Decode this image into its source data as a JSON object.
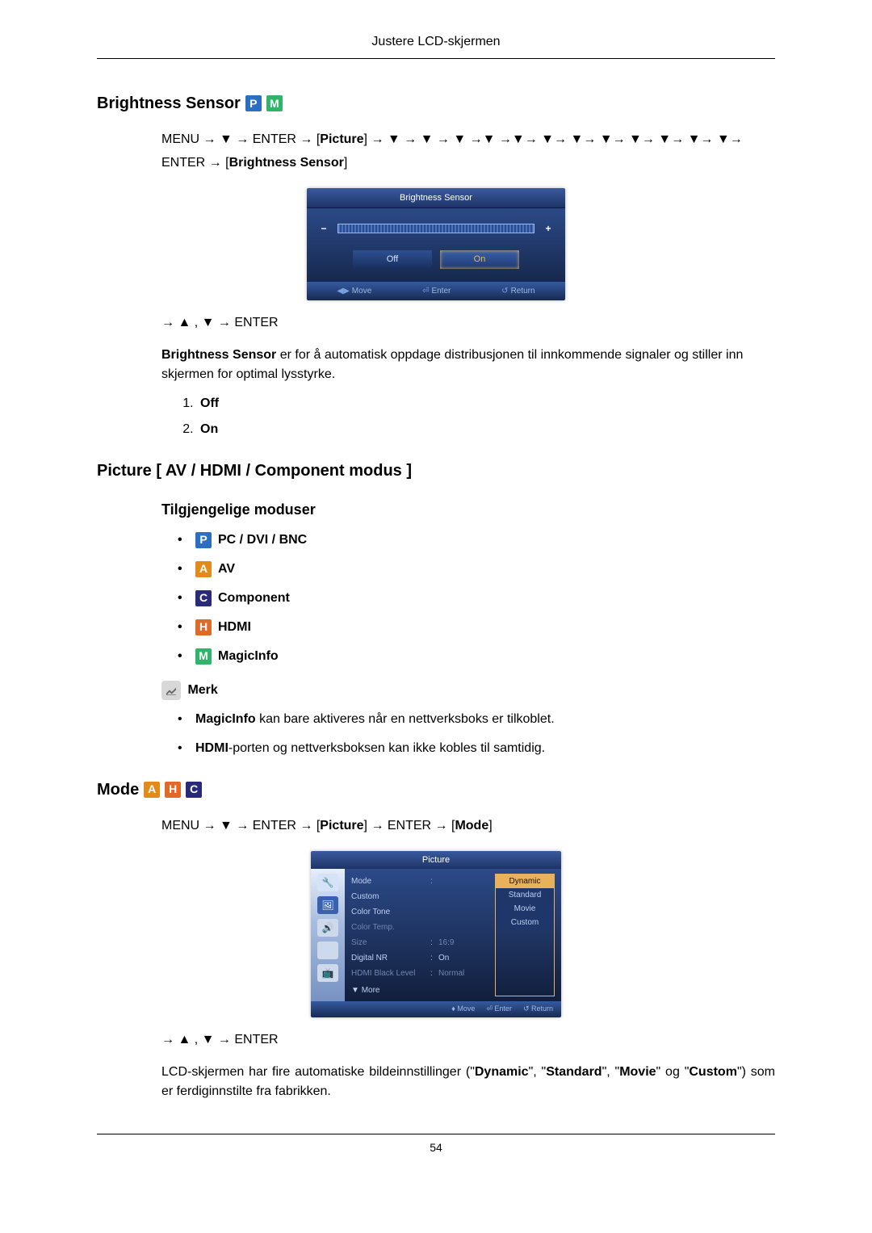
{
  "header": {
    "title": "Justere LCD-skjermen"
  },
  "brightness_sensor": {
    "title": "Brightness Sensor",
    "path_line1_prefix": "MENU → ▼ → ENTER → [",
    "path_line1_picture": "Picture",
    "path_line1_suffix": "] → ▼ → ▼ → ▼ →▼ →▼→ ▼→ ▼→ ▼→ ▼→ ▼→ ▼→ ▼→",
    "path_line2_prefix": "ENTER → [",
    "path_line2_label": "Brightness Sensor",
    "path_line2_suffix": "]",
    "osd": {
      "title": "Brightness Sensor",
      "off": "Off",
      "on": "On",
      "footer_move": "Move",
      "footer_enter": "Enter",
      "footer_return": "Return"
    },
    "nav_after": "→ ▲ , ▼ → ENTER",
    "desc_bold": "Brightness Sensor",
    "desc_rest": " er for å automatisk oppdage distribusjonen til innkommende signaler og stiller inn skjermen for optimal lysstyrke.",
    "options": {
      "off": "Off",
      "on": "On"
    }
  },
  "picture_section": {
    "title": "Picture [ AV / HDMI / Component modus ]",
    "avail_title": "Tilgjengelige moduser",
    "modes": {
      "pc": "PC / DVI / BNC",
      "av": "AV",
      "component": "Component",
      "hdmi": "HDMI",
      "magicinfo": "MagicInfo"
    },
    "note_label": "Merk",
    "note1_bold": "MagicInfo",
    "note1_rest": " kan bare aktiveres når en nettverksboks er tilkoblet.",
    "note2_bold": "HDMI",
    "note2_rest": "-porten og nettverksboksen kan ikke kobles til samtidig."
  },
  "mode_section": {
    "title": "Mode",
    "path_prefix": "MENU → ▼ → ENTER → [",
    "path_picture": "Picture",
    "path_mid": "] → ENTER → [",
    "path_mode": "Mode",
    "path_suffix": "]",
    "osd": {
      "title": "Picture",
      "rows": {
        "mode": "Mode",
        "custom": "Custom",
        "color_tone": "Color Tone",
        "color_temp": "Color Temp.",
        "size": "Size",
        "digital_nr": "Digital NR",
        "hdmi_black": "HDMI Black Level",
        "more": "More"
      },
      "vals": {
        "size": "16:9",
        "digital_nr": "On",
        "hdmi_black": "Normal"
      },
      "dropdown": {
        "dynamic": "Dynamic",
        "standard": "Standard",
        "movie": "Movie",
        "custom": "Custom"
      },
      "footer_move": "Move",
      "footer_enter": "Enter",
      "footer_return": "Return"
    },
    "nav_after": "→ ▲ , ▼ → ENTER",
    "desc_pre": "LCD-skjermen har fire automatiske bildeinnstillinger (\"",
    "desc_dynamic": "Dynamic",
    "desc_mid1": "\", \"",
    "desc_standard": "Standard",
    "desc_mid2": "\", \"",
    "desc_movie": "Movie",
    "desc_mid3": "\" og \"",
    "desc_custom": "Custom",
    "desc_post": "\") som er ferdiginnstilte fra fabrikken."
  },
  "footer": {
    "page": "54"
  }
}
